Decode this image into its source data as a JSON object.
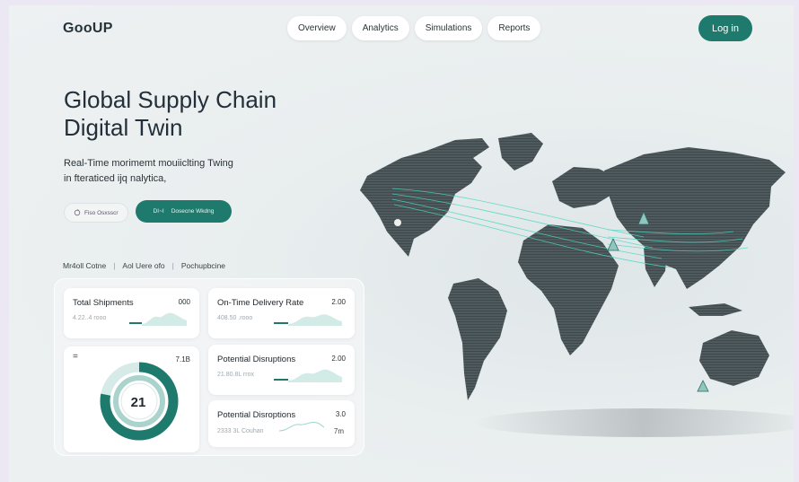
{
  "brand": {
    "logo": "GooUP"
  },
  "nav": {
    "items": [
      "Overview",
      "Analytics",
      "Simulations",
      "Reports"
    ],
    "login": "Log in"
  },
  "hero": {
    "title_line1": "Global Supply Chain",
    "title_line2": "Digital Twin",
    "subtitle_line1": "Real-Time morimemt mouiiclting Twing",
    "subtitle_line2": "in fteraticed ijq nalytica,",
    "btn_secondary": "Fiso Osxsscr",
    "btn_primary_left": "DI~I",
    "btn_primary_right": "Dosecne Wkdng"
  },
  "tabs": [
    "Mr4oll Cotne",
    "Aol Uere ofo",
    "Pochupbcine"
  ],
  "cards": [
    {
      "title": "Total Shipments",
      "value": "000",
      "sub": "4.22..4 rooo"
    },
    {
      "title": "On-Time Delivery Rate",
      "value": "2.00",
      "sub": "408.50 .rooo"
    },
    {
      "title": "Potential Disruptions",
      "value": "2.00",
      "sub": "21.80.8L rrox"
    },
    {
      "title": "Potential Disroptions",
      "value": "3.0",
      "sub": "2333 3L Couhan",
      "badge": "7m"
    }
  ],
  "donut": {
    "label": "=",
    "value_tr": "7.1B",
    "center": "21",
    "fraction": 0.78
  },
  "icons": {
    "ghost_button": "refresh-icon",
    "donut_menu": "equals-icon",
    "map_markers": "beacon-icon"
  },
  "colors": {
    "accent": "#1f7a6e",
    "map": "#4f5a5e",
    "routes": "#4fd6c0"
  }
}
